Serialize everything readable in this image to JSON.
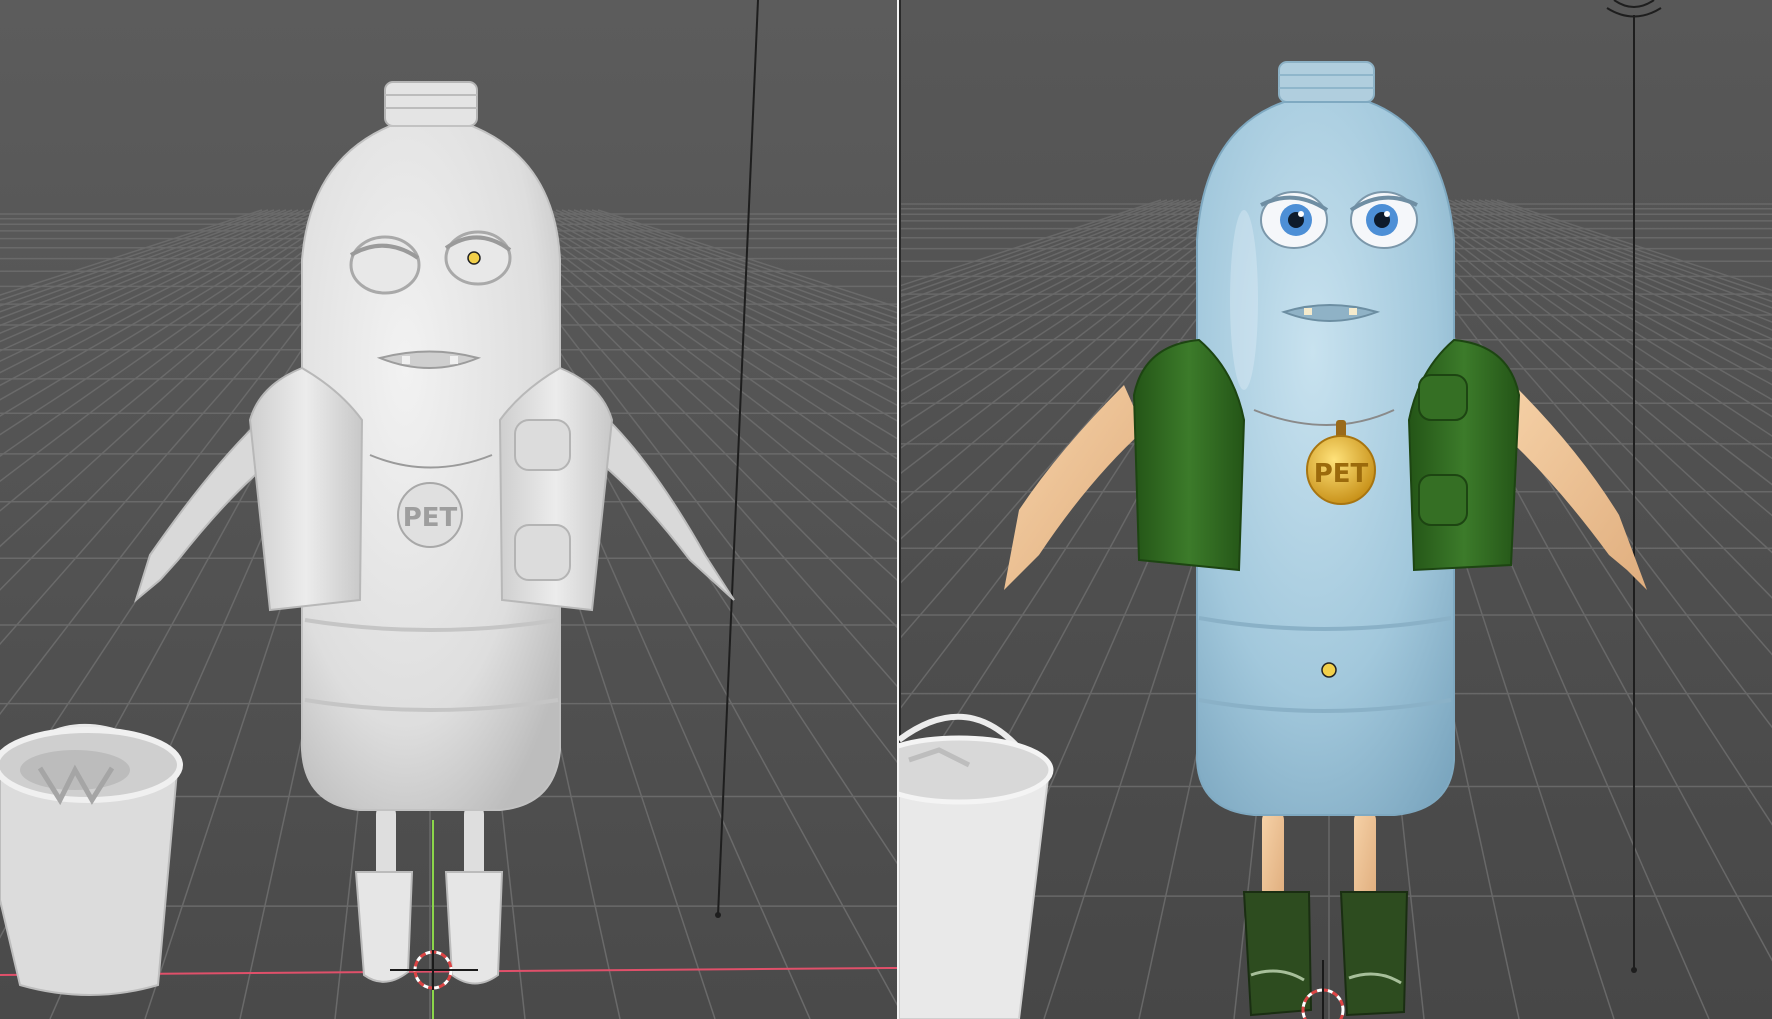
{
  "window": {
    "layout": "two-viewports-side-by-side"
  },
  "viewports": [
    {
      "id": "left",
      "shading": "solid",
      "medal_text": "PET",
      "colors": {
        "background": "#555555",
        "grid": "#6a6a6a",
        "model": "#e3e3e3",
        "x_axis": "#e0506a",
        "y_axis": "#8bd64a",
        "origin": "#f2d04a"
      }
    },
    {
      "id": "right",
      "shading": "material",
      "medal_text": "PET",
      "colors": {
        "background": "#505050",
        "grid": "#686868",
        "bottle": "#a9cde1",
        "vest": "#2f6c21",
        "skin": "#f1c79a",
        "boots": "#2d4c1f",
        "medal": "#e7b42a",
        "eyes": "#4d8fd6",
        "x_axis": "#e0506a",
        "origin": "#f2d04a"
      }
    }
  ]
}
